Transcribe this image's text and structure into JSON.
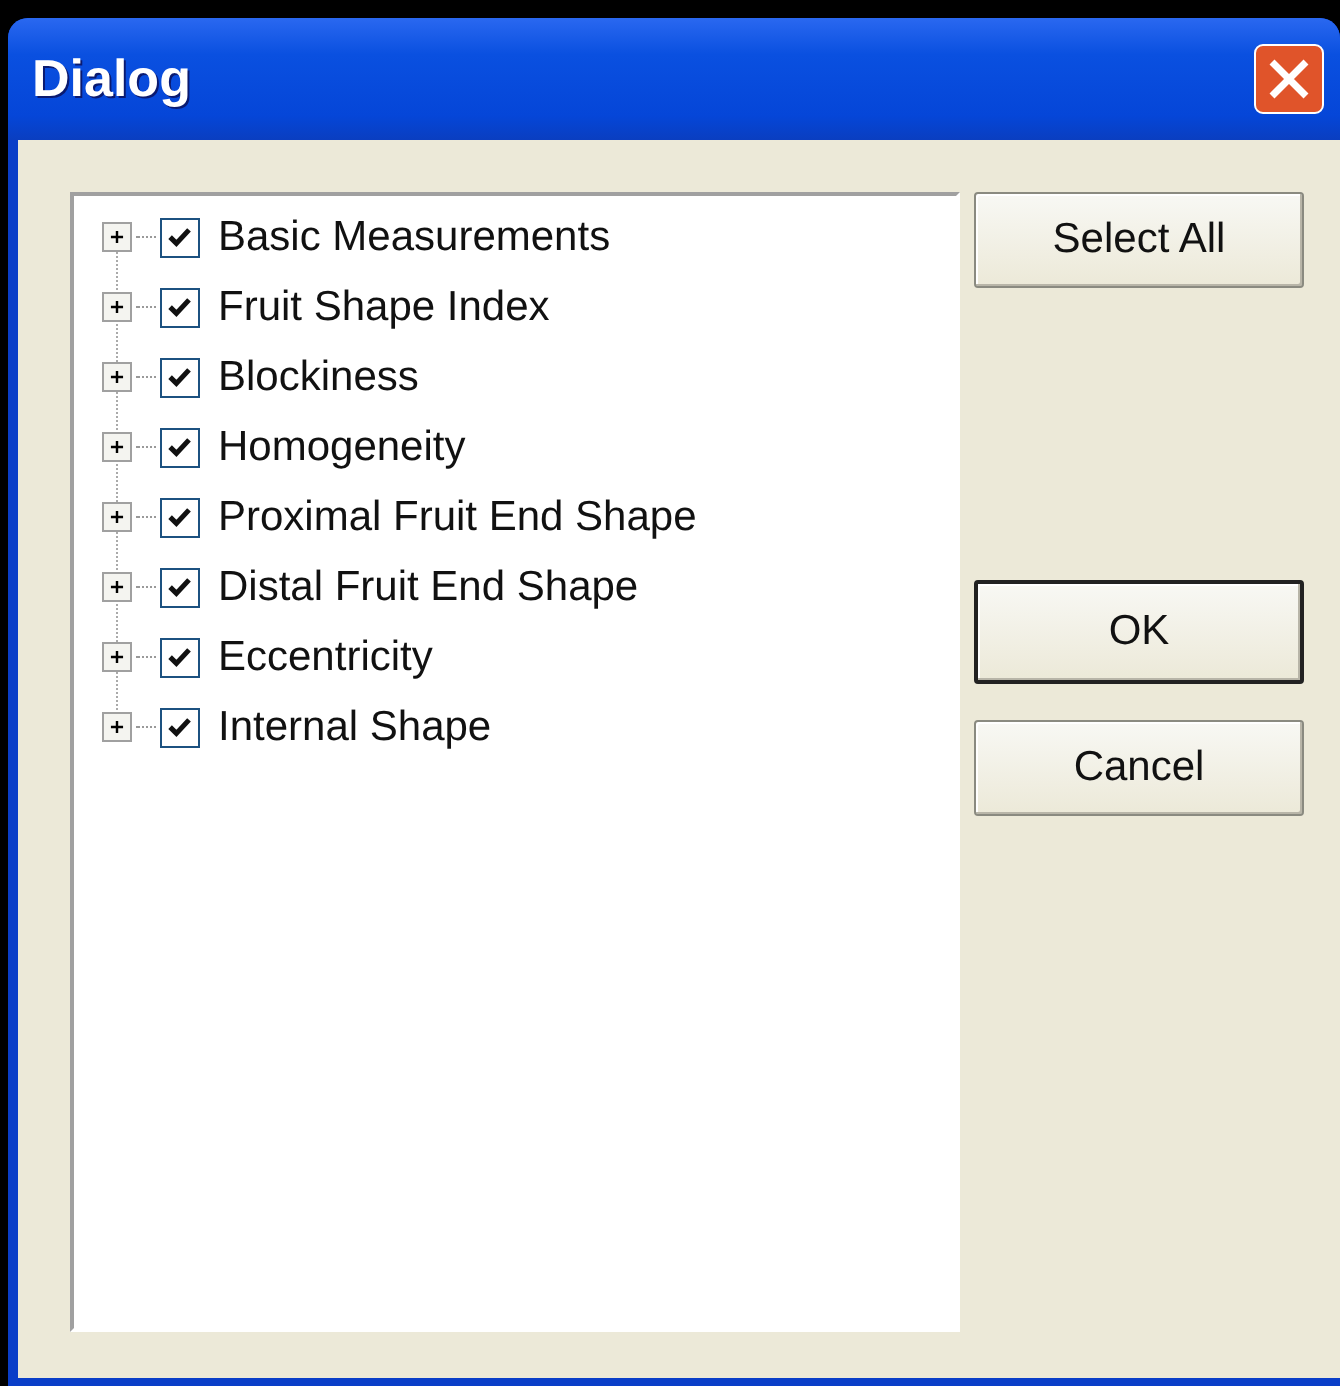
{
  "window": {
    "title": "Dialog"
  },
  "tree": {
    "items": [
      {
        "label": "Basic Measurements",
        "checked": true,
        "expanded": false
      },
      {
        "label": "Fruit Shape Index",
        "checked": true,
        "expanded": false
      },
      {
        "label": "Blockiness",
        "checked": true,
        "expanded": false
      },
      {
        "label": "Homogeneity",
        "checked": true,
        "expanded": false
      },
      {
        "label": "Proximal Fruit End Shape",
        "checked": true,
        "expanded": false
      },
      {
        "label": "Distal Fruit End Shape",
        "checked": true,
        "expanded": false
      },
      {
        "label": "Eccentricity",
        "checked": true,
        "expanded": false
      },
      {
        "label": "Internal Shape",
        "checked": true,
        "expanded": false
      }
    ]
  },
  "buttons": [
    {
      "label": "Select All",
      "kind": "action"
    },
    {
      "label": "OK",
      "kind": "default"
    },
    {
      "label": "Cancel",
      "kind": "normal"
    }
  ]
}
